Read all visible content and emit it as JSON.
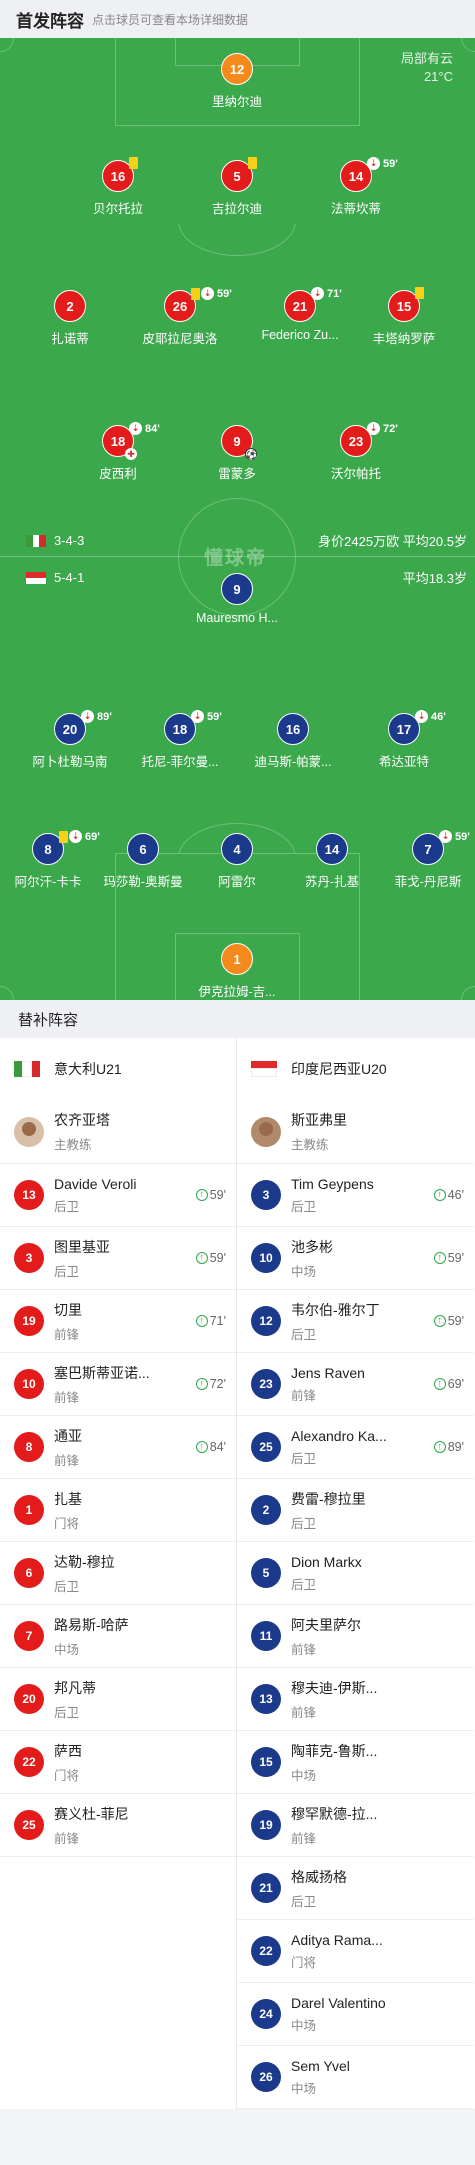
{
  "header": {
    "title": "首发阵容",
    "hint": "点击球员可查看本场详细数据"
  },
  "weather": {
    "condition": "局部有云",
    "temperature": "21°C"
  },
  "watermark": "懂球帝",
  "colors": {
    "pitch": "#3ca84c",
    "home": "#e41b1b",
    "away": "#1b3a8c",
    "goalkeeper": "#f58a1c",
    "yellow_card": "#f5d21a",
    "sub_in": "#2aa84a"
  },
  "home_team": {
    "formation": "3-4-3",
    "stats": "身价2425万欧 平均20.5岁",
    "flag": [
      "#3a9a3a",
      "#ffffff",
      "#d42a2a"
    ],
    "players": [
      {
        "num": "12",
        "name": "里纳尔迪",
        "gk": true,
        "events": []
      },
      {
        "num": "16",
        "name": "贝尔托拉",
        "events": [
          "yellow"
        ]
      },
      {
        "num": "5",
        "name": "吉拉尔迪",
        "events": [
          "yellow"
        ]
      },
      {
        "num": "14",
        "name": "法蒂坎蒂",
        "events": [
          "subout"
        ],
        "minute": "59'"
      },
      {
        "num": "2",
        "name": "扎诺蒂",
        "events": []
      },
      {
        "num": "26",
        "name": "皮耶拉尼奥洛",
        "events": [
          "yellow",
          "subout"
        ],
        "minute": "59'"
      },
      {
        "num": "21",
        "name": "Federico Zu...",
        "events": [
          "subout"
        ],
        "minute": "71'"
      },
      {
        "num": "15",
        "name": "丰塔纳罗萨",
        "events": [
          "yellow"
        ]
      },
      {
        "num": "18",
        "name": "皮西利",
        "events": [
          "subout"
        ],
        "minute": "84'",
        "injury": true
      },
      {
        "num": "9",
        "name": "雷蒙多",
        "events": [],
        "goal": true
      },
      {
        "num": "23",
        "name": "沃尔帕托",
        "events": [
          "subout"
        ],
        "minute": "72'"
      }
    ]
  },
  "away_team": {
    "formation": "5-4-1",
    "stats": "平均18.3岁",
    "flag": [
      "#e02a2a",
      "#ffffff"
    ],
    "players": [
      {
        "num": "9",
        "name": "Mauresmo H...",
        "events": []
      },
      {
        "num": "20",
        "name": "阿卜杜勒马南",
        "events": [
          "subout"
        ],
        "minute": "89'"
      },
      {
        "num": "18",
        "name": "托尼-菲尔曼...",
        "events": [
          "subout"
        ],
        "minute": "59'"
      },
      {
        "num": "16",
        "name": "迪马斯-帕蒙...",
        "events": []
      },
      {
        "num": "17",
        "name": "希达亚特",
        "events": [
          "subout"
        ],
        "minute": "46'"
      },
      {
        "num": "8",
        "name": "阿尔汗-卡卡",
        "events": [
          "yellow",
          "subout"
        ],
        "minute": "69'"
      },
      {
        "num": "6",
        "name": "玛莎勒-奥斯曼",
        "events": []
      },
      {
        "num": "4",
        "name": "阿雷尔",
        "events": []
      },
      {
        "num": "14",
        "name": "苏丹-扎基",
        "events": []
      },
      {
        "num": "7",
        "name": "菲戈-丹尼斯",
        "events": [
          "subout"
        ],
        "minute": "59'"
      },
      {
        "num": "1",
        "name": "伊克拉姆-吉...",
        "gk": true,
        "events": []
      }
    ]
  },
  "subs": {
    "title": "替补阵容",
    "home": {
      "team_name": "意大利U21",
      "coach": {
        "name": "农齐亚塔",
        "role": "主教练"
      },
      "players": [
        {
          "num": "13",
          "name": "Davide Veroli",
          "pos": "后卫",
          "sub_in": "59'"
        },
        {
          "num": "3",
          "name": "图里基亚",
          "pos": "后卫",
          "sub_in": "59'"
        },
        {
          "num": "19",
          "name": "切里",
          "pos": "前锋",
          "sub_in": "71'"
        },
        {
          "num": "10",
          "name": "塞巴斯蒂亚诺...",
          "pos": "前锋",
          "sub_in": "72'"
        },
        {
          "num": "8",
          "name": "通亚",
          "pos": "前锋",
          "sub_in": "84'"
        },
        {
          "num": "1",
          "name": "扎基",
          "pos": "门将",
          "sub_in": ""
        },
        {
          "num": "6",
          "name": "达勒-穆拉",
          "pos": "后卫",
          "sub_in": ""
        },
        {
          "num": "7",
          "name": "路易斯-哈萨",
          "pos": "中场",
          "sub_in": ""
        },
        {
          "num": "20",
          "name": "邦凡蒂",
          "pos": "后卫",
          "sub_in": ""
        },
        {
          "num": "22",
          "name": "萨西",
          "pos": "门将",
          "sub_in": ""
        },
        {
          "num": "25",
          "name": "赛义杜-菲尼",
          "pos": "前锋",
          "sub_in": ""
        }
      ]
    },
    "away": {
      "team_name": "印度尼西亚U20",
      "coach": {
        "name": "斯亚弗里",
        "role": "主教练"
      },
      "players": [
        {
          "num": "3",
          "name": "Tim Geypens",
          "pos": "后卫",
          "sub_in": "46'"
        },
        {
          "num": "10",
          "name": "池多彬",
          "pos": "中场",
          "sub_in": "59'"
        },
        {
          "num": "12",
          "name": "韦尔伯-雅尔丁",
          "pos": "后卫",
          "sub_in": "59'"
        },
        {
          "num": "23",
          "name": "Jens Raven",
          "pos": "前锋",
          "sub_in": "69'"
        },
        {
          "num": "25",
          "name": "Alexandro Ka...",
          "pos": "后卫",
          "sub_in": "89'"
        },
        {
          "num": "2",
          "name": "费雷-穆拉里",
          "pos": "后卫",
          "sub_in": ""
        },
        {
          "num": "5",
          "name": "Dion Markx",
          "pos": "后卫",
          "sub_in": ""
        },
        {
          "num": "11",
          "name": "阿夫里萨尔",
          "pos": "前锋",
          "sub_in": ""
        },
        {
          "num": "13",
          "name": "穆夫迪-伊斯...",
          "pos": "前锋",
          "sub_in": ""
        },
        {
          "num": "15",
          "name": "陶菲克-鲁斯...",
          "pos": "中场",
          "sub_in": ""
        },
        {
          "num": "19",
          "name": "穆罕默德-拉...",
          "pos": "前锋",
          "sub_in": ""
        },
        {
          "num": "21",
          "name": "格威扬格",
          "pos": "后卫",
          "sub_in": ""
        },
        {
          "num": "22",
          "name": "Aditya Rama...",
          "pos": "门将",
          "sub_in": ""
        },
        {
          "num": "24",
          "name": "Darel Valentino",
          "pos": "中场",
          "sub_in": ""
        },
        {
          "num": "26",
          "name": "Sem Yvel",
          "pos": "中场",
          "sub_in": ""
        }
      ]
    }
  }
}
